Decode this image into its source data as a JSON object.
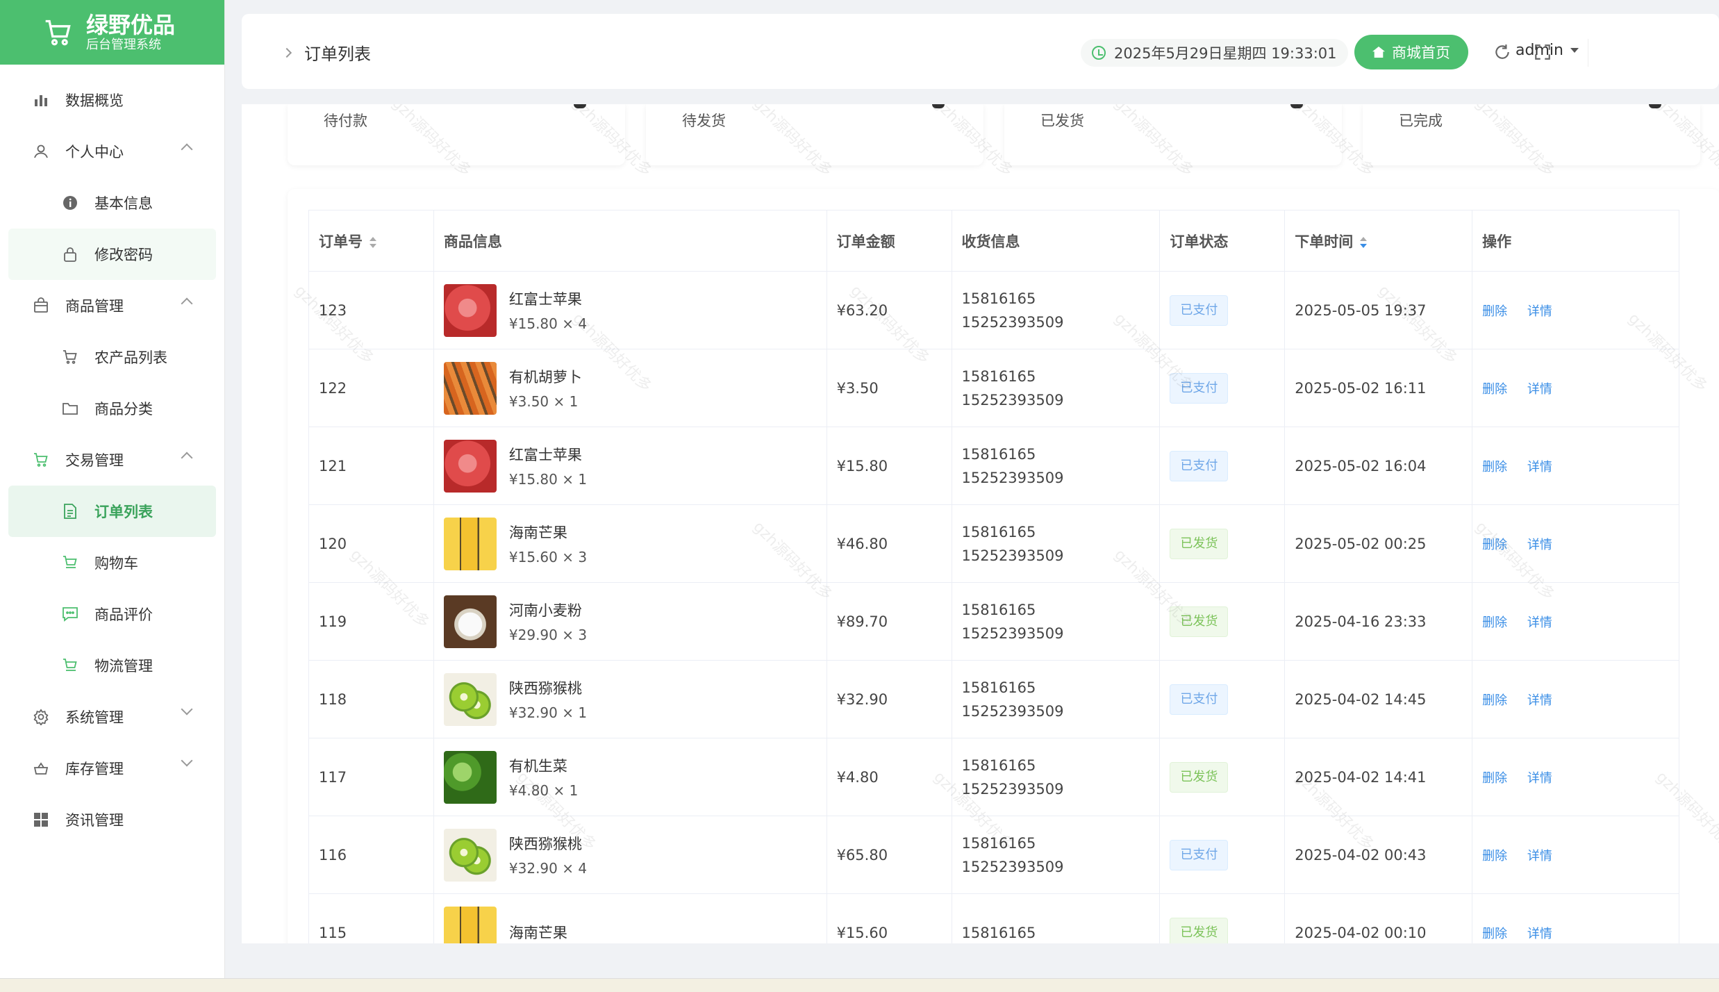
{
  "brand": {
    "title": "绿野优品",
    "subtitle": "后台管理系统"
  },
  "sidebar": {
    "items": [
      {
        "label": "数据概览",
        "icon": "bar-chart-icon"
      },
      {
        "label": "个人中心",
        "icon": "user-icon",
        "expanded": true
      },
      {
        "label": "基本信息",
        "icon": "info-icon",
        "sub": true
      },
      {
        "label": "修改密码",
        "icon": "lock-icon",
        "sub": true
      },
      {
        "label": "商品管理",
        "icon": "bag-icon",
        "expanded": true
      },
      {
        "label": "农产品列表",
        "icon": "cart-icon",
        "sub": true
      },
      {
        "label": "商品分类",
        "icon": "folder-icon",
        "sub": true
      },
      {
        "label": "交易管理",
        "icon": "cart-icon",
        "expanded": true
      },
      {
        "label": "订单列表",
        "icon": "document-icon",
        "sub": true,
        "active": true
      },
      {
        "label": "购物车",
        "icon": "cart-icon",
        "sub": true
      },
      {
        "label": "商品评价",
        "icon": "comment-icon",
        "sub": true
      },
      {
        "label": "物流管理",
        "icon": "truck-icon",
        "sub": true
      },
      {
        "label": "系统管理",
        "icon": "gear-icon",
        "expanded": false
      },
      {
        "label": "库存管理",
        "icon": "basket-icon",
        "expanded": false
      },
      {
        "label": "资讯管理",
        "icon": "grid-icon"
      }
    ]
  },
  "header": {
    "breadcrumb": "订单列表",
    "datetime": "2025年5月29日星期四 19:33:01",
    "home_button": "商城首页",
    "user": "admin"
  },
  "stats": [
    {
      "label": "待付款"
    },
    {
      "label": "待发货"
    },
    {
      "label": "已发货"
    },
    {
      "label": "已完成"
    }
  ],
  "table": {
    "columns": [
      "订单号",
      "商品信息",
      "订单金额",
      "收货信息",
      "订单状态",
      "下单时间",
      "操作"
    ],
    "actions": {
      "delete": "删除",
      "detail": "详情"
    },
    "rows": [
      {
        "id": "123",
        "name": "红富士苹果",
        "price": "¥15.80 × 4",
        "amount": "¥63.20",
        "phone": "15816165",
        "phone2": "15252393509",
        "status": "已支付",
        "time": "2025-05-05 19:37",
        "thumb": "apple"
      },
      {
        "id": "122",
        "name": "有机胡萝卜",
        "price": "¥3.50 × 1",
        "amount": "¥3.50",
        "phone": "15816165",
        "phone2": "15252393509",
        "status": "已支付",
        "time": "2025-05-02 16:11",
        "thumb": "carrot"
      },
      {
        "id": "121",
        "name": "红富士苹果",
        "price": "¥15.80 × 1",
        "amount": "¥15.80",
        "phone": "15816165",
        "phone2": "15252393509",
        "status": "已支付",
        "time": "2025-05-02 16:04",
        "thumb": "apple"
      },
      {
        "id": "120",
        "name": "海南芒果",
        "price": "¥15.60 × 3",
        "amount": "¥46.80",
        "phone": "15816165",
        "phone2": "15252393509",
        "status": "已发货",
        "time": "2025-05-02 00:25",
        "thumb": "mango"
      },
      {
        "id": "119",
        "name": "河南小麦粉",
        "price": "¥29.90 × 3",
        "amount": "¥89.70",
        "phone": "15816165",
        "phone2": "15252393509",
        "status": "已发货",
        "time": "2025-04-16 23:33",
        "thumb": "flour"
      },
      {
        "id": "118",
        "name": "陕西猕猴桃",
        "price": "¥32.90 × 1",
        "amount": "¥32.90",
        "phone": "15816165",
        "phone2": "15252393509",
        "status": "已支付",
        "time": "2025-04-02 14:45",
        "thumb": "kiwi"
      },
      {
        "id": "117",
        "name": "有机生菜",
        "price": "¥4.80 × 1",
        "amount": "¥4.80",
        "phone": "15816165",
        "phone2": "15252393509",
        "status": "已发货",
        "time": "2025-04-02 14:41",
        "thumb": "lettuce"
      },
      {
        "id": "116",
        "name": "陕西猕猴桃",
        "price": "¥32.90 × 4",
        "amount": "¥65.80",
        "phone": "15816165",
        "phone2": "15252393509",
        "status": "已支付",
        "time": "2025-04-02 00:43",
        "thumb": "kiwi"
      },
      {
        "id": "115",
        "name": "海南芒果",
        "price": "",
        "amount": "¥15.60",
        "phone": "15816165",
        "phone2": "",
        "status": "已发货",
        "time": "2025-04-02 00:10",
        "thumb": "mango"
      }
    ]
  },
  "colors": {
    "brand": "#4cbf6f",
    "link": "#3a8ee6",
    "paid": "#6fa7e8",
    "shipped": "#7cc35a"
  }
}
